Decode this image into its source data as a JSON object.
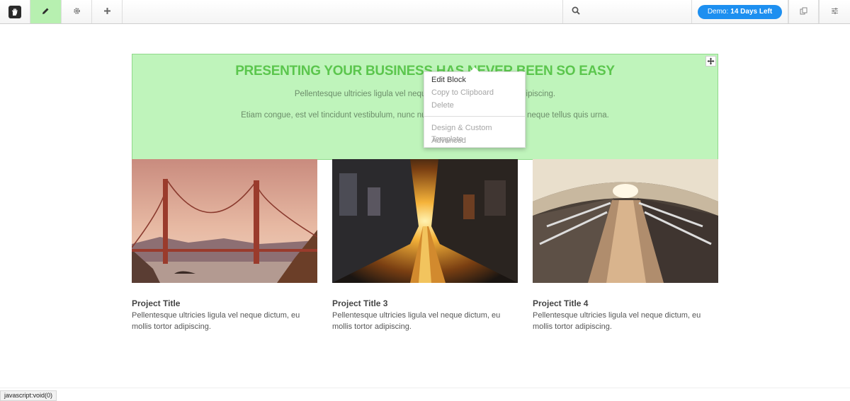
{
  "toolbar": {
    "logo_icon": "concrete5-hand-logo",
    "edit_icon": "pencil-icon",
    "settings_icon": "gear-icon",
    "add_icon": "plus-icon",
    "search_icon": "search-icon",
    "demo_prefix": "Demo:",
    "demo_days": "14 Days Left",
    "demo_color": "#1d8ff0",
    "pages_icon": "pages-icon",
    "panel_icon": "sliders-icon",
    "active_color": "#b7f0b0"
  },
  "hero": {
    "title": "PRESENTING YOUR BUSINESS HAS NEVER BEEN SO EASY",
    "line1": "Pellentesque ultricies ligula vel neque dictum, eu mollis tortor adipiscing.",
    "line2": "Etiam congue, est vel tincidunt vestibulum, nunc nunc porta nulla, at adipiscing neque tellus quis urna.",
    "background": "#bff4bb",
    "title_color": "#5bc64d"
  },
  "context_menu": {
    "items": [
      {
        "label": "Edit Block"
      },
      {
        "label": "Copy to Clipboard"
      },
      {
        "label": "Delete"
      },
      {
        "label": "Design & Custom Template"
      },
      {
        "label": "Advanced"
      }
    ]
  },
  "projects": [
    {
      "title": "Project Title",
      "text": "Pellentesque ultricies ligula vel neque dictum, eu mollis tortor adipiscing.",
      "image": "golden-gate-bridge-photo"
    },
    {
      "title": "Project Title 3",
      "text": "Pellentesque ultricies ligula vel neque dictum, eu mollis tortor adipiscing.",
      "image": "sunset-street-photo"
    },
    {
      "title": "Project Title 4",
      "text": "Pellentesque ultricies ligula vel neque dictum, eu mollis tortor adipiscing.",
      "image": "escalator-tunnel-photo"
    }
  ],
  "status_bar": {
    "text": "javascript:void(0)"
  }
}
